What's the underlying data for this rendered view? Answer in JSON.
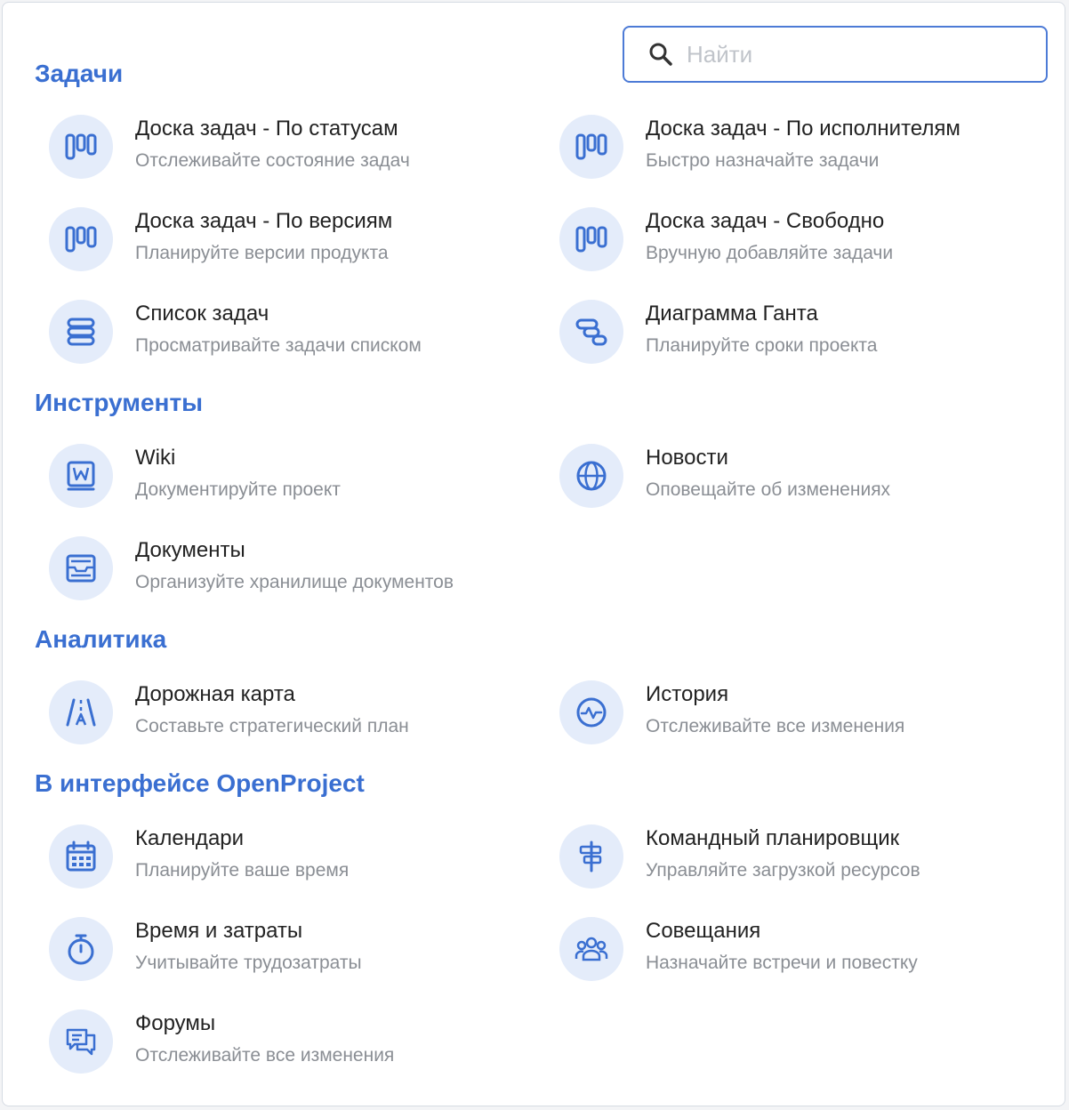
{
  "search": {
    "placeholder": "Найти"
  },
  "sections": [
    {
      "title": "Задачи",
      "items": [
        {
          "title": "Доска задач - По статусам",
          "desc": "Отслеживайте состояние задач",
          "icon": "board-icon"
        },
        {
          "title": "Доска задач - По исполнителям",
          "desc": "Быстро назначайте задачи",
          "icon": "board-icon"
        },
        {
          "title": "Доска задач - По версиям",
          "desc": "Планируйте версии продукта",
          "icon": "board-icon"
        },
        {
          "title": "Доска задач - Свободно",
          "desc": "Вручную добавляйте задачи",
          "icon": "board-icon"
        },
        {
          "title": "Список задач",
          "desc": "Просматривайте задачи списком",
          "icon": "list-icon"
        },
        {
          "title": "Диаграмма Ганта",
          "desc": "Планируйте сроки проекта",
          "icon": "gantt-icon"
        }
      ]
    },
    {
      "title": "Инструменты",
      "items": [
        {
          "title": "Wiki",
          "desc": "Документируйте проект",
          "icon": "wiki-icon"
        },
        {
          "title": "Новости",
          "desc": "Оповещайте об изменениях",
          "icon": "globe-icon"
        },
        {
          "title": "Документы",
          "desc": "Организуйте хранилище документов",
          "icon": "documents-icon"
        }
      ]
    },
    {
      "title": "Аналитика",
      "items": [
        {
          "title": "Дорожная карта",
          "desc": "Составьте стратегический план",
          "icon": "roadmap-icon"
        },
        {
          "title": "История",
          "desc": "Отслеживайте все изменения",
          "icon": "activity-icon"
        }
      ]
    },
    {
      "title": "В интерфейсе OpenProject",
      "items": [
        {
          "title": "Календари",
          "desc": "Планируйте ваше время",
          "icon": "calendar-icon"
        },
        {
          "title": "Командный планировщик",
          "desc": "Управляйте загрузкой ресурсов",
          "icon": "team-planner-icon"
        },
        {
          "title": "Время и затраты",
          "desc": "Учитывайте трудозатраты",
          "icon": "stopwatch-icon"
        },
        {
          "title": "Совещания",
          "desc": "Назначайте встречи и повестку",
          "icon": "people-icon"
        },
        {
          "title": "Форумы",
          "desc": "Отслеживайте все изменения",
          "icon": "forums-icon"
        }
      ]
    }
  ],
  "colors": {
    "accent": "#3a6fd1",
    "icon_bg": "#e4ecfa",
    "title_text": "#222222",
    "desc_text": "#8a8e94"
  }
}
